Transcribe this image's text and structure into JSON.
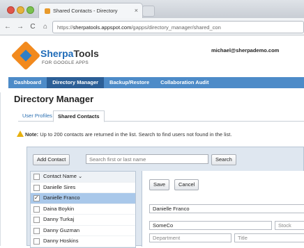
{
  "browser": {
    "tab_title": "Shared Contacts - Directory",
    "tab_close": "×",
    "url_host": "sherpatools.appspot.com",
    "url_rest": "/gapps/directory_manager/shared_con",
    "url_scheme": "https://",
    "nav": {
      "back": "←",
      "forward": "→",
      "reload": "C",
      "home": "⌂",
      "star": "☆"
    }
  },
  "header": {
    "brand_main": "Sherpa",
    "brand_suffix": "Tools",
    "brand_sub": "FOR GOOGLE APPS",
    "user_email": "michael@sherpademo.com"
  },
  "main_nav": {
    "items": [
      "Dashboard",
      "Directory Manager",
      "Backup/Restore",
      "Collaboration Audit"
    ],
    "active": "Directory Manager"
  },
  "page": {
    "title": "Directory Manager",
    "subtabs": [
      "User Profiles",
      "Shared Contacts"
    ],
    "note_label": "Note:",
    "note_text": "Up to 200 contacts are returned in the list. Search to find users not found in the list."
  },
  "toolbar": {
    "add_contact": "Add Contact",
    "search_placeholder": "Search first or last name",
    "search_button": "Search"
  },
  "contacts": {
    "header": "Contact Name ⌄",
    "rows": [
      "Danielle Sires",
      "Danielle Franco",
      "Daina Boykin",
      "Danny Turkaj",
      "Danny Guzman",
      "Danny Hoskins"
    ],
    "selected": "Danielle Franco"
  },
  "detail": {
    "save": "Save",
    "cancel": "Cancel",
    "full_name": "Danielle Franco",
    "company": "SomeCo",
    "stock_placeholder": "Stock",
    "department_placeholder": "Department",
    "title_placeholder": "Title"
  }
}
